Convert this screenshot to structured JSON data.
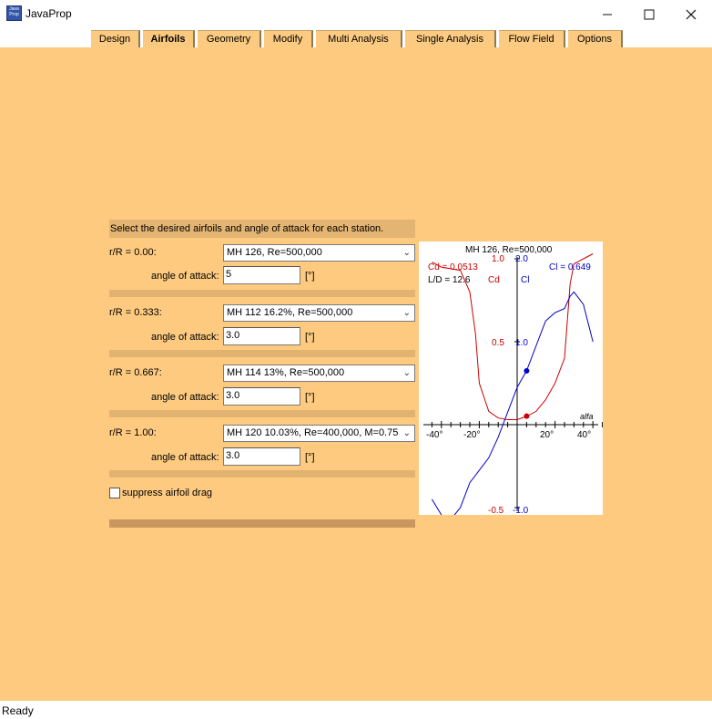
{
  "window": {
    "title": "JavaProp",
    "icon_text": "Java Prop",
    "minimize_icon": "minimize-icon",
    "maximize_icon": "maximize-icon",
    "close_icon": "close-icon"
  },
  "tabs": [
    {
      "label": "Design"
    },
    {
      "label": "Airfoils",
      "active": true
    },
    {
      "label": "Geometry"
    },
    {
      "label": "Modify"
    },
    {
      "label": "Multi Analysis"
    },
    {
      "label": "Single Analysis"
    },
    {
      "label": "Flow Field"
    },
    {
      "label": "Options"
    }
  ],
  "panel": {
    "header": "Select the desired airfoils and angle of attack for each station.",
    "stations": [
      {
        "rR_label": "r/R = 0.00:",
        "airfoil": "MH 126, Re=500,000",
        "aoa_label": "angle of attack:",
        "aoa_value": "5",
        "unit": "[°]"
      },
      {
        "rR_label": "r/R = 0.333:",
        "airfoil": "MH 112 16.2%, Re=500,000",
        "aoa_label": "angle of attack:",
        "aoa_value": "3.0",
        "unit": "[°]"
      },
      {
        "rR_label": "r/R = 0.667:",
        "airfoil": "MH 114 13%, Re=500,000",
        "aoa_label": "angle of attack:",
        "aoa_value": "3.0",
        "unit": "[°]"
      },
      {
        "rR_label": "r/R = 1.00:",
        "airfoil": "MH 120 10.03%, Re=400,000, M=0.75",
        "aoa_label": "angle of attack:",
        "aoa_value": "3.0",
        "unit": "[°]"
      }
    ],
    "suppress_label": "suppress airfoil drag",
    "suppress_checked": false
  },
  "plot": {
    "title": "MH 126, Re=500,000",
    "cd_readout": "Cd = 0.0513",
    "ld_readout": "L/D = 12.6",
    "cl_readout": "Cl = 0.649",
    "cd_axis_label": "Cd",
    "cl_axis_label": "Cl",
    "x_axis_label": "alfa",
    "tick_labels": {
      "cd_top": "1.0",
      "cl_top": "2.0",
      "cd_mid": "0.5",
      "cl_mid": "1.0",
      "cd_bottom": "-0.5",
      "cl_bottom": "-1.0",
      "x_neg40": "-40°",
      "x_neg20": "-20°",
      "x_20": "20°",
      "x_40": "40°"
    },
    "colors": {
      "cd": "#cc0000",
      "cl": "#0000cc",
      "axis": "#000000"
    }
  },
  "chart_data": {
    "type": "line",
    "title": "MH 126, Re=500,000",
    "xlabel": "alfa",
    "x_unit": "deg",
    "xlim": [
      -45,
      45
    ],
    "ylim_cl": [
      -1.0,
      2.0
    ],
    "ylim_cd": [
      -0.5,
      1.0
    ],
    "series": [
      {
        "name": "Cl",
        "color": "#0000cc",
        "x": [
          -45,
          -37,
          -30,
          -25,
          -20,
          -15,
          -10,
          -5,
          0,
          5,
          10,
          15,
          20,
          25,
          28,
          30,
          35,
          40
        ],
        "y": [
          -0.9,
          -1.2,
          -1.0,
          -0.7,
          -0.55,
          -0.4,
          -0.15,
          0.15,
          0.45,
          0.65,
          0.95,
          1.25,
          1.35,
          1.4,
          1.55,
          1.6,
          1.45,
          1.0
        ]
      },
      {
        "name": "Cd",
        "color": "#cc0000",
        "x": [
          -45,
          -40,
          -30,
          -25,
          -22,
          -20,
          -15,
          -10,
          -5,
          0,
          5,
          10,
          15,
          20,
          25,
          28,
          30,
          35,
          40
        ],
        "y": [
          0.98,
          0.95,
          0.93,
          0.8,
          0.55,
          0.25,
          0.08,
          0.04,
          0.03,
          0.03,
          0.05,
          0.08,
          0.15,
          0.25,
          0.4,
          0.85,
          0.97,
          1.0,
          1.03
        ]
      }
    ],
    "operating_points": [
      {
        "series": "Cl",
        "x": 5,
        "y": 0.649
      },
      {
        "series": "Cd",
        "x": 5,
        "y": 0.0513
      }
    ]
  },
  "status": {
    "text": "Ready"
  }
}
